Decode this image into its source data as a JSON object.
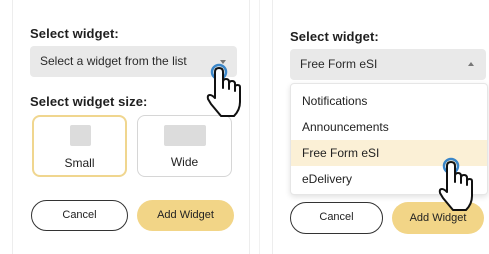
{
  "left": {
    "select_heading": "Select widget:",
    "select_placeholder": "Select a widget from the list",
    "size_heading": "Select widget size:",
    "sizes": [
      {
        "label": "Small"
      },
      {
        "label": "Wide"
      }
    ],
    "cancel_label": "Cancel",
    "add_label": "Add Widget"
  },
  "right": {
    "select_heading": "Select widget:",
    "select_value": "Free Form eSI",
    "menu_items": [
      "Notifications",
      "Announcements",
      "Free Form eSI",
      "eDelivery"
    ],
    "selected_index": 2,
    "cancel_label": "Cancel",
    "add_label": "Add Widget"
  },
  "colors": {
    "accent": "#f2d587",
    "selected_border": "#f0d68f",
    "highlight": "#fbf0d6",
    "cursor_ring": "#3a86c8",
    "select_bg": "#e9e9e9"
  },
  "icons": [
    "chevron-down-icon",
    "chevron-up-icon",
    "hand-pointer-icon"
  ]
}
